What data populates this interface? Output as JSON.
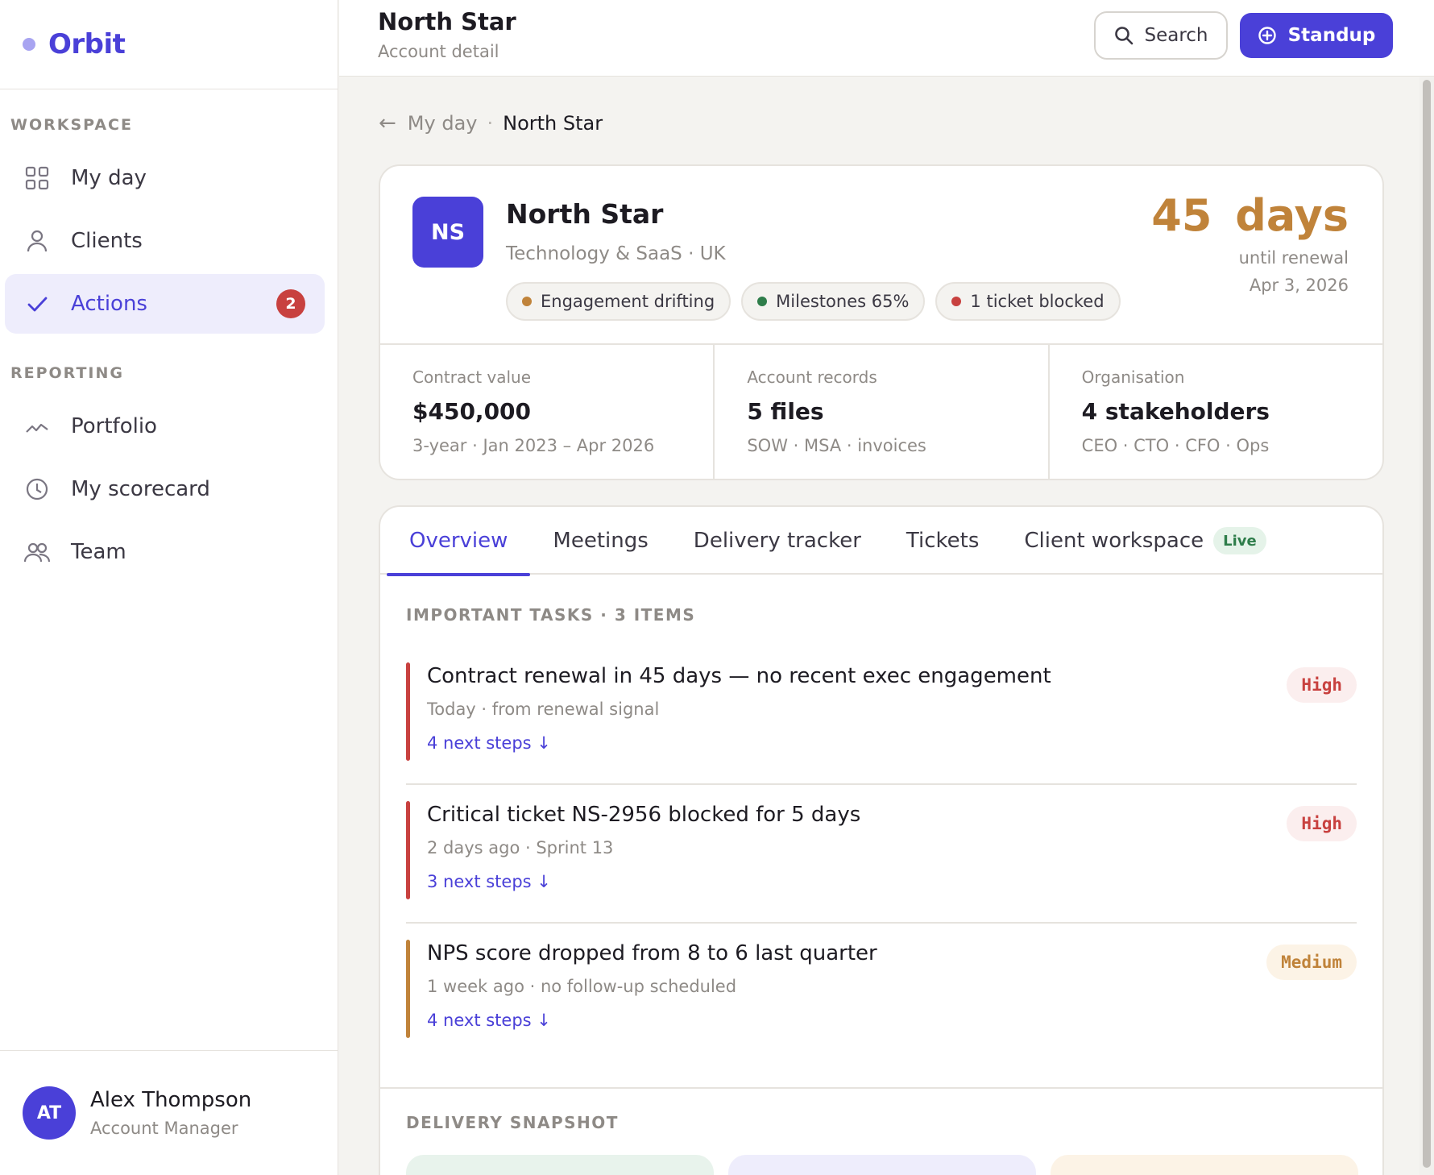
{
  "brand": {
    "name": "Orbit"
  },
  "sidebar": {
    "sections": [
      {
        "label": "WORKSPACE"
      },
      {
        "label": "REPORTING"
      }
    ],
    "items": [
      {
        "label": "My day",
        "icon": "grid-icon"
      },
      {
        "label": "Clients",
        "icon": "user-icon"
      },
      {
        "label": "Actions",
        "icon": "check-icon",
        "badge": "2",
        "active": true
      },
      {
        "label": "Portfolio",
        "icon": "trend-icon"
      },
      {
        "label": "My scorecard",
        "icon": "clock-icon"
      },
      {
        "label": "Team",
        "icon": "team-icon"
      }
    ],
    "user": {
      "initials": "AT",
      "name": "Alex Thompson",
      "role": "Account Manager"
    }
  },
  "header": {
    "title": "North Star",
    "subtitle": "Account detail",
    "search_label": "Search",
    "standup_label": "Standup"
  },
  "breadcrumb": {
    "back_icon": "←",
    "link": "My day",
    "separator": "·",
    "current": "North Star"
  },
  "account": {
    "initials": "NS",
    "name": "North Star",
    "meta": "Technology & SaaS · UK",
    "pills": [
      {
        "label": "Engagement drifting",
        "color": "#c0833a"
      },
      {
        "label": "Milestones 65%",
        "color": "#2e7d4a"
      },
      {
        "label": "1 ticket blocked",
        "color": "#c8413f"
      }
    ],
    "renewal": {
      "days": "45 days",
      "label": "until renewal",
      "date": "Apr 3, 2026"
    },
    "stats": [
      {
        "label": "Contract value",
        "value": "$450,000",
        "sub": "3-year · Jan 2023 – Apr 2026"
      },
      {
        "label": "Account records",
        "value": "5 files",
        "sub": "SOW · MSA · invoices"
      },
      {
        "label": "Organisation",
        "value": "4 stakeholders",
        "sub": "CEO · CTO · CFO · Ops"
      }
    ]
  },
  "tabs": [
    {
      "label": "Overview",
      "active": true
    },
    {
      "label": "Meetings"
    },
    {
      "label": "Delivery tracker"
    },
    {
      "label": "Tickets"
    },
    {
      "label": "Client workspace",
      "badge": "Live"
    }
  ],
  "tasks": {
    "title": "IMPORTANT TASKS · 3 ITEMS",
    "items": [
      {
        "title": "Contract renewal in 45 days — no recent exec engagement",
        "meta": "Today · from renewal signal",
        "steps": "4 next steps ↓",
        "priority": "High",
        "color": "#c8413f"
      },
      {
        "title": "Critical ticket NS-2956 blocked for 5 days",
        "meta": "2 days ago · Sprint 13",
        "steps": "3 next steps ↓",
        "priority": "High",
        "color": "#c8413f"
      },
      {
        "title": "NPS score dropped from 8 to 6 last quarter",
        "meta": "1 week ago · no follow-up scheduled",
        "steps": "4 next steps ↓",
        "priority": "Medium",
        "color": "#c0833a"
      }
    ]
  },
  "delivery": {
    "title": "DELIVERY SNAPSHOT"
  },
  "colors": {
    "accent": "#4a40d8",
    "danger": "#c8413f",
    "warning": "#c0833a",
    "success": "#2e7d4a"
  }
}
